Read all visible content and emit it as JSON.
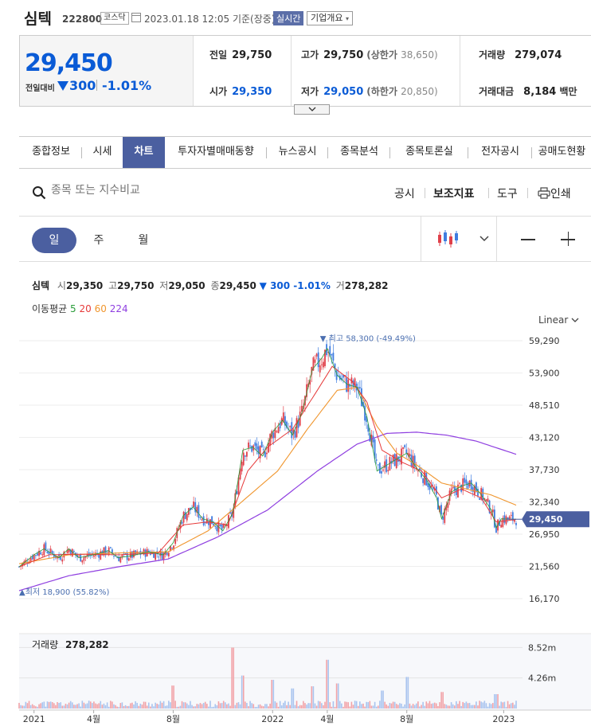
{
  "header": {
    "name": "심텍",
    "code": "222800",
    "market": "코스닥",
    "datetime": "2023.01.18 12:05",
    "basis": "기준(장중)",
    "realtime": "실시간",
    "company_btn": "기업개요"
  },
  "quote": {
    "price": "29,450",
    "change_label": "전일대비",
    "change": "300",
    "change_pct": "-1.01%",
    "prev_label": "전일",
    "prev": "29,750",
    "open_label": "시가",
    "open": "29,350",
    "high_label": "고가",
    "high": "29,750",
    "upper_label": "(상한가",
    "upper": "38,650)",
    "low_label": "저가",
    "low": "29,050",
    "lower_label": "(하한가",
    "lower": "20,850)",
    "volume_label": "거래량",
    "volume": "279,074",
    "amount_label": "거래대금",
    "amount": "8,184",
    "amount_unit": "백만"
  },
  "tabs": [
    "종합정보",
    "시세",
    "차트",
    "투자자별매매동향",
    "뉴스공시",
    "종목분석",
    "종목토론실",
    "전자공시",
    "공매도현황"
  ],
  "active_tab": 2,
  "toolbar": {
    "search_placeholder": "종목 또는 지수비교",
    "disclosure": "공시",
    "indicators": "보조지표",
    "tools": "도구",
    "print": "인쇄"
  },
  "periods": [
    "일",
    "주",
    "월"
  ],
  "active_period": 0,
  "chart_info": {
    "name": "심텍",
    "open_label": "시",
    "open": "29,350",
    "high_label": "고",
    "high": "29,750",
    "low_label": "저",
    "low": "29,050",
    "close_label": "종",
    "close": "29,450",
    "change": "▼ 300 -1.01%",
    "vol_label": "거",
    "vol": "278,282",
    "ma_label": "이동평균",
    "ma5": "5",
    "ma20": "20",
    "ma60": "60",
    "ma224": "224",
    "scale": "Linear"
  },
  "chart_data": {
    "type": "line",
    "y_ticks": [
      "59,290",
      "53,900",
      "48,510",
      "43,120",
      "37,730",
      "32,340",
      "26,950",
      "21,560",
      "16,170"
    ],
    "y_tick_values": [
      59290,
      53900,
      48510,
      43120,
      37730,
      32340,
      26950,
      21560,
      16170
    ],
    "x_ticks": [
      "2021",
      "4월",
      "8월",
      "2022",
      "4월",
      "8월",
      "2023"
    ],
    "x_tick_positions": [
      0.03,
      0.15,
      0.31,
      0.51,
      0.62,
      0.78,
      0.975
    ],
    "current_price": "29,450",
    "current_value": 29450,
    "max_label": "최고 58,300 (-49.49%)",
    "max_value": 58300,
    "max_pos": 0.615,
    "min_label": "최저 18,900 (55.82%)",
    "min_value": 18900,
    "min_pos": 0.0,
    "close_series": [
      [
        0.0,
        21500
      ],
      [
        0.03,
        23500
      ],
      [
        0.05,
        24500
      ],
      [
        0.08,
        23000
      ],
      [
        0.1,
        24500
      ],
      [
        0.12,
        23000
      ],
      [
        0.15,
        23500
      ],
      [
        0.18,
        24200
      ],
      [
        0.2,
        23000
      ],
      [
        0.23,
        23400
      ],
      [
        0.26,
        24000
      ],
      [
        0.29,
        23500
      ],
      [
        0.31,
        25500
      ],
      [
        0.33,
        30000
      ],
      [
        0.35,
        31500
      ],
      [
        0.37,
        29500
      ],
      [
        0.39,
        29000
      ],
      [
        0.41,
        27500
      ],
      [
        0.43,
        30500
      ],
      [
        0.45,
        41000
      ],
      [
        0.47,
        41500
      ],
      [
        0.49,
        40000
      ],
      [
        0.51,
        44000
      ],
      [
        0.53,
        46000
      ],
      [
        0.55,
        43500
      ],
      [
        0.57,
        47500
      ],
      [
        0.59,
        54500
      ],
      [
        0.61,
        56500
      ],
      [
        0.62,
        58000
      ],
      [
        0.64,
        53500
      ],
      [
        0.66,
        52000
      ],
      [
        0.68,
        51500
      ],
      [
        0.7,
        46500
      ],
      [
        0.72,
        37500
      ],
      [
        0.74,
        38500
      ],
      [
        0.76,
        39500
      ],
      [
        0.78,
        40500
      ],
      [
        0.8,
        38000
      ],
      [
        0.82,
        36000
      ],
      [
        0.84,
        33000
      ],
      [
        0.85,
        29500
      ],
      [
        0.87,
        34000
      ],
      [
        0.89,
        35000
      ],
      [
        0.91,
        35500
      ],
      [
        0.93,
        33500
      ],
      [
        0.95,
        31000
      ],
      [
        0.96,
        28000
      ],
      [
        0.97,
        29500
      ],
      [
        1.0,
        29450
      ]
    ],
    "ma224": [
      [
        0.0,
        17500
      ],
      [
        0.1,
        20000
      ],
      [
        0.2,
        21500
      ],
      [
        0.3,
        22800
      ],
      [
        0.4,
        26500
      ],
      [
        0.5,
        31000
      ],
      [
        0.6,
        37500
      ],
      [
        0.68,
        42000
      ],
      [
        0.74,
        43800
      ],
      [
        0.8,
        44000
      ],
      [
        0.86,
        43500
      ],
      [
        0.92,
        42500
      ],
      [
        1.0,
        40300
      ]
    ],
    "ma60": [
      [
        0.0,
        22000
      ],
      [
        0.1,
        23500
      ],
      [
        0.2,
        23800
      ],
      [
        0.3,
        24000
      ],
      [
        0.38,
        27500
      ],
      [
        0.45,
        32500
      ],
      [
        0.52,
        37500
      ],
      [
        0.58,
        44500
      ],
      [
        0.64,
        51000
      ],
      [
        0.68,
        51500
      ],
      [
        0.72,
        45000
      ],
      [
        0.76,
        40500
      ],
      [
        0.8,
        38500
      ],
      [
        0.85,
        35500
      ],
      [
        0.9,
        34500
      ],
      [
        0.95,
        33500
      ],
      [
        1.0,
        31800
      ]
    ],
    "ma20": [
      [
        0.0,
        21500
      ],
      [
        0.06,
        23500
      ],
      [
        0.12,
        23600
      ],
      [
        0.2,
        23500
      ],
      [
        0.28,
        23800
      ],
      [
        0.33,
        28500
      ],
      [
        0.38,
        29000
      ],
      [
        0.42,
        28500
      ],
      [
        0.46,
        37500
      ],
      [
        0.5,
        41500
      ],
      [
        0.55,
        44500
      ],
      [
        0.6,
        51000
      ],
      [
        0.63,
        55000
      ],
      [
        0.67,
        52500
      ],
      [
        0.7,
        49000
      ],
      [
        0.73,
        41000
      ],
      [
        0.77,
        39000
      ],
      [
        0.81,
        37500
      ],
      [
        0.85,
        33000
      ],
      [
        0.89,
        34500
      ],
      [
        0.93,
        33000
      ],
      [
        0.96,
        29000
      ],
      [
        1.0,
        29400
      ]
    ],
    "volume_label": "거래량",
    "volume_value": "278,282",
    "volume_ticks": [
      "8.52m",
      "4.26m"
    ],
    "volume_tick_values": [
      8.52,
      4.26
    ],
    "volume_max": 10.0,
    "volume_spikes": [
      [
        0.31,
        3.2
      ],
      [
        0.43,
        8.5
      ],
      [
        0.45,
        4.6
      ],
      [
        0.51,
        4.0
      ],
      [
        0.55,
        2.8
      ],
      [
        0.59,
        3.1
      ],
      [
        0.62,
        6.8
      ],
      [
        0.64,
        3.5
      ],
      [
        0.73,
        2.5
      ],
      [
        0.78,
        4.4
      ],
      [
        0.85,
        2.3
      ],
      [
        0.96,
        2.0
      ]
    ],
    "colors": {
      "up": "#e0404a",
      "down": "#3f7de0",
      "ma5": "#2a9d3a",
      "ma20": "#e63a3a",
      "ma60": "#f0962e",
      "ma224": "#8f3fe0"
    }
  }
}
